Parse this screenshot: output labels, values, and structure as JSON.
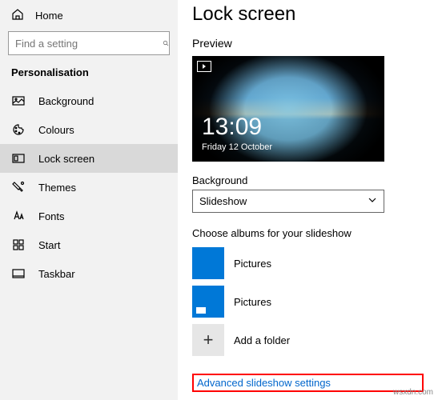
{
  "sidebar": {
    "home": "Home",
    "search_placeholder": "Find a setting",
    "section": "Personalisation",
    "items": [
      {
        "label": "Background"
      },
      {
        "label": "Colours"
      },
      {
        "label": "Lock screen"
      },
      {
        "label": "Themes"
      },
      {
        "label": "Fonts"
      },
      {
        "label": "Start"
      },
      {
        "label": "Taskbar"
      }
    ]
  },
  "main": {
    "title": "Lock screen",
    "preview_label": "Preview",
    "preview": {
      "time": "13:09",
      "date": "Friday 12 October"
    },
    "bg_label": "Background",
    "bg_value": "Slideshow",
    "albums_label": "Choose albums for your slideshow",
    "albums": [
      {
        "label": "Pictures"
      },
      {
        "label": "Pictures"
      }
    ],
    "add_folder": "Add a folder",
    "advanced_link": "Advanced slideshow settings"
  },
  "watermark": "wsxdn.com"
}
